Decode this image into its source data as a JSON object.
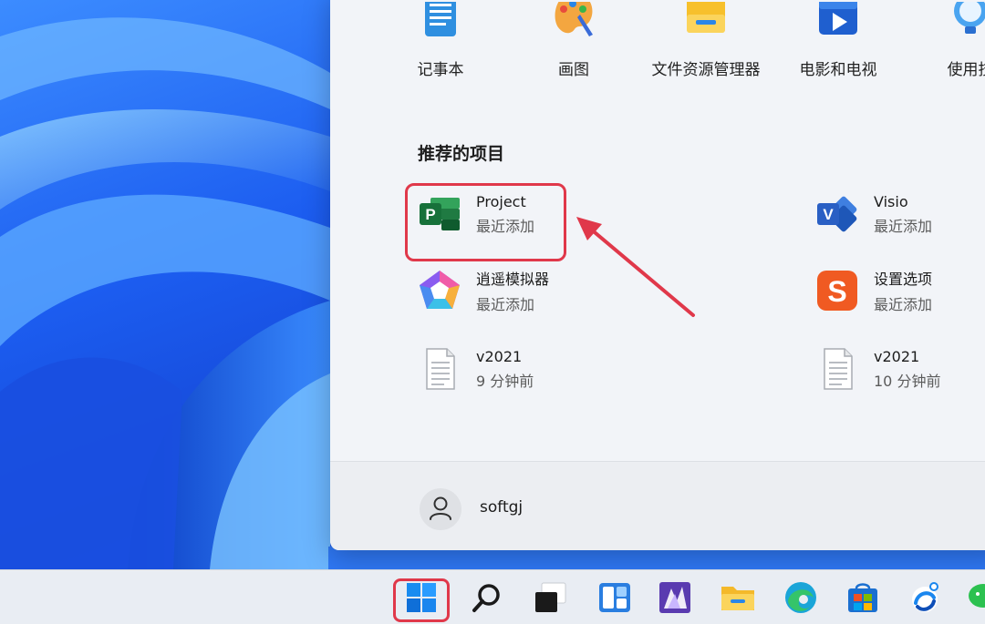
{
  "pinned_apps": [
    {
      "label": "记事本",
      "icon": "notepad-icon"
    },
    {
      "label": "画图",
      "icon": "paint-icon"
    },
    {
      "label": "文件资源管理器",
      "icon": "file-explorer-icon"
    },
    {
      "label": "电影和电视",
      "icon": "movies-tv-icon"
    },
    {
      "label": "使用技",
      "icon": "tips-icon"
    }
  ],
  "recommended": {
    "title": "推荐的项目",
    "items": [
      {
        "name": "Project",
        "sub": "最近添加",
        "icon": "ms-project-icon"
      },
      {
        "name": "Visio",
        "sub": "最近添加",
        "icon": "ms-visio-icon"
      },
      {
        "name": "逍遥模拟器",
        "sub": "最近添加",
        "icon": "memu-emulator-icon"
      },
      {
        "name": "设置选项",
        "sub": "最近添加",
        "icon": "sogou-input-icon"
      },
      {
        "name": "v2021",
        "sub": "9 分钟前",
        "icon": "document-icon"
      },
      {
        "name": "v2021",
        "sub": "10 分钟前",
        "icon": "document-icon"
      }
    ]
  },
  "user": {
    "name": "softgj",
    "icon": "user-icon"
  },
  "taskbar": [
    {
      "icon": "windows-start-icon"
    },
    {
      "icon": "search-icon"
    },
    {
      "icon": "task-view-icon"
    },
    {
      "icon": "widgets-icon"
    },
    {
      "icon": "app-launcher-icon"
    },
    {
      "icon": "file-explorer-icon"
    },
    {
      "icon": "edge-icon"
    },
    {
      "icon": "store-icon"
    },
    {
      "icon": "network-icon"
    },
    {
      "icon": "wechat-icon"
    }
  ],
  "colors": {
    "highlight": "#e0384a",
    "accent": "#0067c0"
  }
}
